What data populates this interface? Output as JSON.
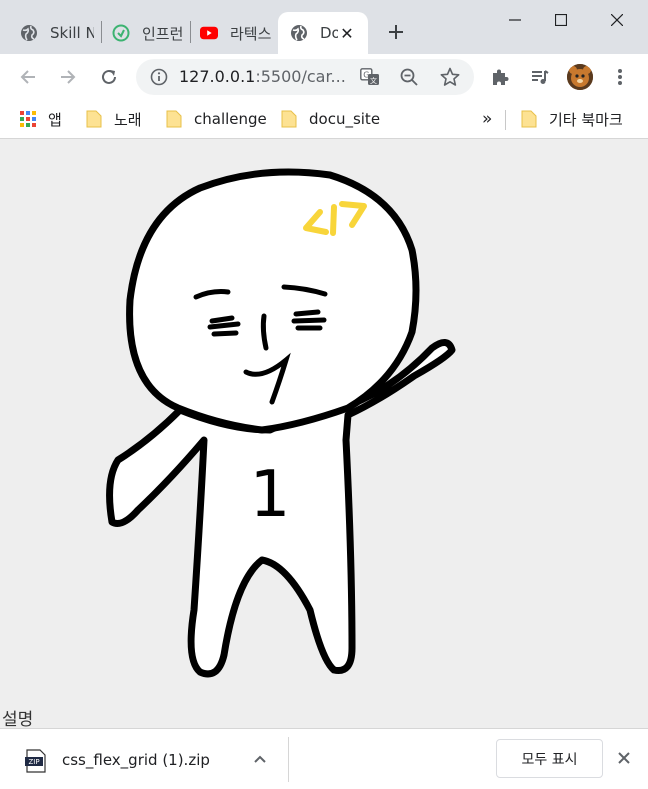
{
  "tabs": [
    {
      "title": "Skill N",
      "icon": "globe-icon"
    },
    {
      "title": "인프런",
      "icon": "inflearn-icon"
    },
    {
      "title": "라텍스",
      "icon": "youtube-icon"
    },
    {
      "title": "Do",
      "icon": "globe-icon",
      "active": true
    }
  ],
  "toolbar": {
    "url_host": "127.0.0.1",
    "url_rest": ":5500/car..."
  },
  "bookmarks": {
    "apps": "앱",
    "items": [
      "노래",
      "challenge",
      "docu_site"
    ],
    "overflow": "»",
    "other": "기타 북마크"
  },
  "page": {
    "drawing_text": "1",
    "caption": "설명"
  },
  "downloads": {
    "file_name": "css_flex_grid (1).zip",
    "show_all": "모두 표시"
  },
  "colors": {
    "tabstrip": "#dee1e6",
    "page_bg": "#eeeeee",
    "yellow_mark": "#f8d53a"
  }
}
